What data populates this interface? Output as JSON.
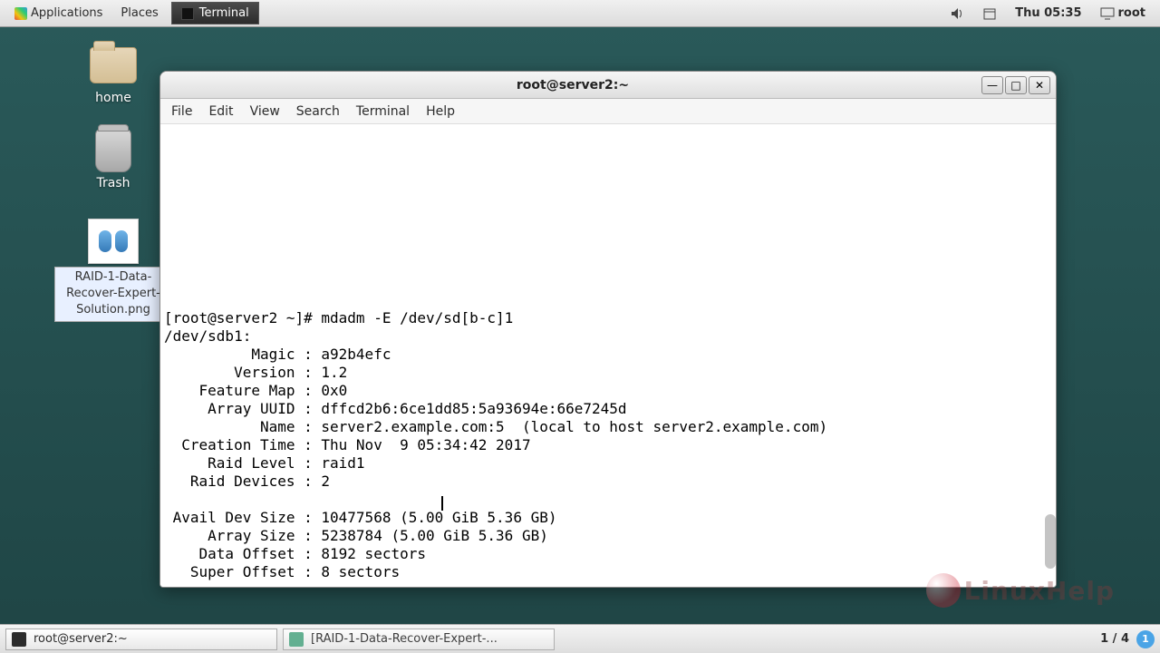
{
  "top_panel": {
    "applications": "Applications",
    "places": "Places",
    "active_app": "Terminal",
    "clock": "Thu 05:35",
    "user": "root"
  },
  "desktop": {
    "home": "home",
    "trash": "Trash",
    "raid_png": "RAID-1-Data-Recover-Expert-Solution.png"
  },
  "terminal": {
    "title": "root@server2:~",
    "menus": {
      "file": "File",
      "edit": "Edit",
      "view": "View",
      "search": "Search",
      "terminal": "Terminal",
      "help": "Help"
    },
    "lines": {
      "l0": "[root@server2 ~]# mdadm -E /dev/sd[b-c]1",
      "l1": "/dev/sdb1:",
      "l2": "          Magic : a92b4efc",
      "l3": "        Version : 1.2",
      "l4": "    Feature Map : 0x0",
      "l5": "     Array UUID : dffcd2b6:6ce1dd85:5a93694e:66e7245d",
      "l6": "           Name : server2.example.com:5  (local to host server2.example.com)",
      "l7": "  Creation Time : Thu Nov  9 05:34:42 2017",
      "l8": "     Raid Level : raid1",
      "l9": "   Raid Devices : 2",
      "l10": "",
      "l11": " Avail Dev Size : 10477568 (5.00 GiB 5.36 GB)",
      "l12": "     Array Size : 5238784 (5.00 GiB 5.36 GB)",
      "l13": "    Data Offset : 8192 sectors",
      "l14": "   Super Offset : 8 sectors"
    }
  },
  "bottom": {
    "task1": "root@server2:~",
    "task2": "[RAID-1-Data-Recover-Expert-...",
    "page": "1 / 4",
    "page_num": "1"
  },
  "watermark": "LinuxHelp"
}
